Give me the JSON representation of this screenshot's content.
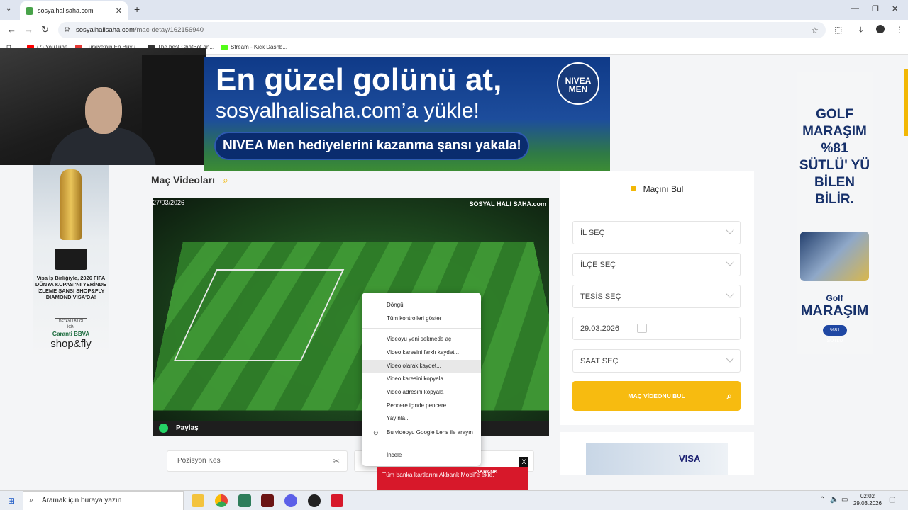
{
  "browser": {
    "tab_title": "sosyalhalisaha.com",
    "url_domain": "sosyalhalisaha.com",
    "url_path": "/mac-detay/162156940",
    "bookmarks": [
      {
        "label": "(7) YouTube",
        "color": "#ff0000"
      },
      {
        "label": "Türkiye'nin En Büyü...",
        "color": "#e53935"
      },
      {
        "label": "The best ChatBot an...",
        "color": "#333333"
      },
      {
        "label": "Stream - Kick Dashb...",
        "color": "#53fc18"
      }
    ]
  },
  "top_ad": {
    "line1": "En güzel golünü at,",
    "line2": "sosyalhalisaha.com’a yükle!",
    "line3": "NIVEA Men hediyelerini kazanma şansı yakala!",
    "logo": "NIVEA MEN"
  },
  "left_ad": {
    "text": "Visa İş Birliğiyle, 2026 FIFA DÜNYA KUPASI'NI YERİNDE İZLEME ŞANSI SHOP&FLY DIAMOND VISA'DA!",
    "button": "DETAYLI BİLGİ İÇİN",
    "brand": "Garanti BBVA",
    "brand2": "shop&fly"
  },
  "right_ad": {
    "headline": "GOLF MARAŞIM %81 SÜTLÜ' YÜ BİLEN BİLİR.",
    "golf": "Golf",
    "marasim": "MARAŞIM",
    "badge": "%81 SÜTLÜ"
  },
  "section": {
    "title": "Maç Videoları"
  },
  "video": {
    "date": "27/03/2026",
    "watermark": "SOSYAL HALI SAHA.com",
    "share_label": "Paylaş"
  },
  "context_menu": {
    "items": [
      "Döngü",
      "Tüm kontrolleri göster",
      "Videoyu yeni sekmede aç",
      "Video karesini farklı kaydet...",
      "Video olarak kaydet...",
      "Video karesini kopyala",
      "Video adresini kopyala",
      "Pencere içinde pencere",
      "Yayınla...",
      "Bu videoyu Google Lens ile arayın",
      "İncele"
    ],
    "highlighted": "Video olarak kaydet..."
  },
  "cut_box": {
    "label": "Pozisyon Kes"
  },
  "finder": {
    "title": "Maçını Bul",
    "il": "İL SEÇ",
    "ilce": "İLÇE SEÇ",
    "tesis": "TESİS SEÇ",
    "date": "29.03.2026",
    "saat": "SAAT SEÇ",
    "button": "MAÇ VİDEONU BUL",
    "ad_text": "VISA"
  },
  "bottom_ad": {
    "text": "Tüm banka kartlarını Akbank Mobil'e ekle,",
    "logo": "AKBANK",
    "close": "X"
  },
  "taskbar": {
    "search_placeholder": "Aramak için buraya yazın",
    "time": "02:02",
    "date": "29.03.2026"
  }
}
